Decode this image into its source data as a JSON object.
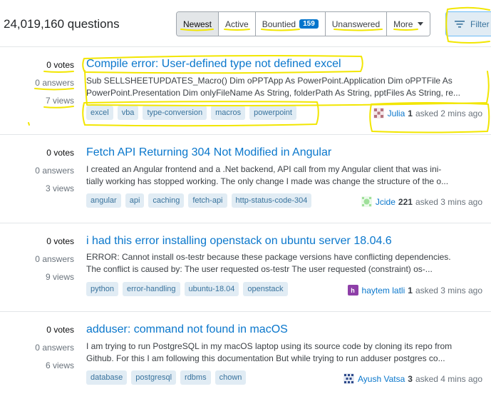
{
  "header": {
    "question_count": "24,019,160 questions",
    "filters": [
      {
        "label": "Newest",
        "selected": true
      },
      {
        "label": "Active"
      },
      {
        "label": "Bountied",
        "badge": "159"
      },
      {
        "label": "Unanswered"
      },
      {
        "label": "More"
      }
    ],
    "filter_button": "Filter"
  },
  "colors": {
    "link": "#0a77cc",
    "tag_bg": "#e1ecf4",
    "tag_text": "#39739d",
    "bounty_badge": "#0074cc",
    "annotation_highlight": "#f2e600"
  },
  "questions": [
    {
      "votes": "0",
      "votes_label": "votes",
      "answers": "0",
      "answers_label": "answers",
      "views": "7",
      "views_label": "views",
      "title": "Compile error: User-defined type not defined excel",
      "excerpt_lines": [
        "Sub SELLSHEETUPDATES_Macro() Dim oPPTApp As PowerPoint.Application Dim oPPTFile As",
        "PowerPoint.Presentation Dim onlyFileName As String, folderPath As String, pptFiles As String, re..."
      ],
      "tags": [
        "excel",
        "vba",
        "type-conversion",
        "macros",
        "powerpoint"
      ],
      "user": "Julia",
      "rep": "1",
      "asked": "asked 2 mins ago",
      "avatar_color": "#b5737d",
      "avatar_icon": "identicon-icon"
    },
    {
      "votes": "0",
      "votes_label": "votes",
      "answers": "0",
      "answers_label": "answers",
      "views": "3",
      "views_label": "views",
      "title": "Fetch API Returning 304 Not Modified in Angular",
      "excerpt_lines": [
        "I created an Angular frontend and a .Net backend, API call from my Angular client that was ini-",
        "tially working has stopped working. The only change I made was change the structure of the o..."
      ],
      "tags": [
        "angular",
        "api",
        "caching",
        "fetch-api",
        "http-status-code-304"
      ],
      "user": "Jcide",
      "rep": "221",
      "asked": "asked 3 mins ago",
      "avatar_color": "#9fe09a",
      "avatar_icon": "identicon-icon"
    },
    {
      "votes": "0",
      "votes_label": "votes",
      "answers": "0",
      "answers_label": "answers",
      "views": "9",
      "views_label": "views",
      "title": "i had this error installing openstack on ubuntu server 18.04.6",
      "excerpt_lines": [
        "ERROR: Cannot install os-testr because these package versions have conflicting dependencies.",
        "The conflict is caused by: The user requested os-testr The user requested (constraint) os-..."
      ],
      "tags": [
        "python",
        "error-handling",
        "ubuntu-18.04",
        "openstack"
      ],
      "user": "haytem latli",
      "rep": "1",
      "asked": "asked 3 mins ago",
      "avatar_color": "#8e3fa8",
      "avatar_letter": "h"
    },
    {
      "votes": "0",
      "votes_label": "votes",
      "answers": "0",
      "answers_label": "answers",
      "views": "6",
      "views_label": "views",
      "title": "adduser: command not found in macOS",
      "excerpt_lines": [
        "I am trying to run PostgreSQL in my macOS laptop using its source code by cloning its repo from",
        "Github. For this I am following this documentation But while trying to run adduser postgres co..."
      ],
      "tags": [
        "database",
        "postgresql",
        "rdbms",
        "chown"
      ],
      "user": "Ayush Vatsa",
      "rep": "3",
      "asked": "asked 4 mins ago",
      "avatar_color": "#2e4a8a",
      "avatar_icon": "identicon-icon"
    }
  ]
}
